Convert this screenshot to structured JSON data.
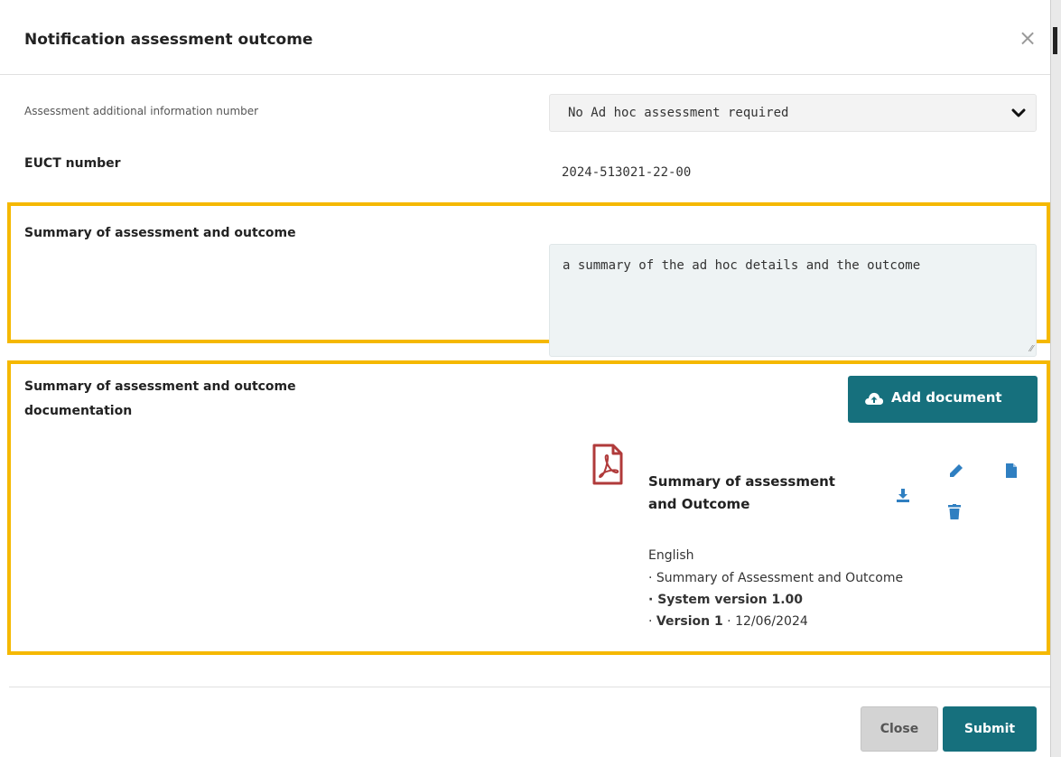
{
  "modal": {
    "title": "Notification assessment outcome",
    "close_symbol": "×"
  },
  "form": {
    "assessment_number_label": "Assessment additional information number",
    "assessment_number_value": "No Ad hoc assessment required",
    "euct_label": "EUCT number",
    "euct_value": "2024-513021-22-00",
    "summary_label": "Summary of assessment and outcome",
    "summary_value": "a summary of the ad hoc details and the outcome",
    "documentation_label_line1": "Summary of assessment and outcome",
    "documentation_label_line2": "documentation"
  },
  "documents": {
    "add_button_label": "Add document",
    "add_button_icon": "cloud-upload-icon",
    "items": [
      {
        "type_icon": "pdf-file-icon",
        "title_line1": "Summary of assessment",
        "title_line2": "and Outcome",
        "language": "English",
        "doc_type": "· Summary of Assessment and Outcome",
        "system_version": "· System version 1.00",
        "version_prefix": "· ",
        "version": "Version 1",
        "date": " · 12/06/2024"
      }
    ]
  },
  "footer": {
    "close_label": "Close",
    "submit_label": "Submit"
  },
  "colors": {
    "primary": "#16707d",
    "highlight": "#f5b800",
    "pdf_red": "#b03a3a",
    "action_blue": "#2f7fc1"
  }
}
